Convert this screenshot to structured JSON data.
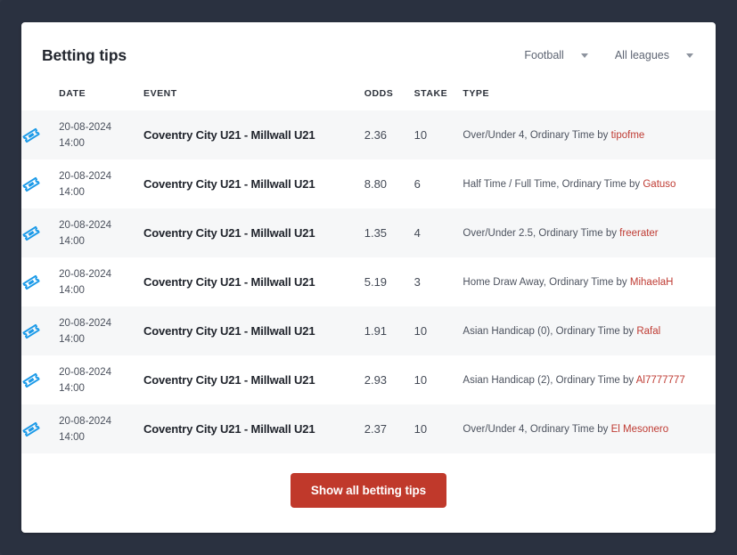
{
  "page": {
    "background_color": "#2a3140"
  },
  "card": {
    "title": "Betting tips",
    "filters": [
      {
        "name": "sport",
        "label": "Football",
        "icon": "chevron-down-icon"
      },
      {
        "name": "league",
        "label": "All leagues",
        "icon": "chevron-down-icon"
      }
    ],
    "table": {
      "columns": [
        "DATE",
        "EVENT",
        "ODDS",
        "STAKE",
        "TYPE"
      ],
      "rows": [
        {
          "icon": "ticket-icon",
          "date": "20-08-2024",
          "time": "14:00",
          "event": "Coventry City U21 - Millwall U21",
          "odds": "2.36",
          "stake": "10",
          "type": "Over/Under 4, Ordinary Time by",
          "tipster": "tipofme"
        },
        {
          "icon": "ticket-icon",
          "date": "20-08-2024",
          "time": "14:00",
          "event": "Coventry City U21 - Millwall U21",
          "odds": "8.80",
          "stake": "6",
          "type": "Half Time / Full Time, Ordinary Time by",
          "tipster": "Gatuso"
        },
        {
          "icon": "ticket-icon",
          "date": "20-08-2024",
          "time": "14:00",
          "event": "Coventry City U21 - Millwall U21",
          "odds": "1.35",
          "stake": "4",
          "type": "Over/Under 2.5, Ordinary Time by",
          "tipster": "freerater"
        },
        {
          "icon": "ticket-icon",
          "date": "20-08-2024",
          "time": "14:00",
          "event": "Coventry City U21 - Millwall U21",
          "odds": "5.19",
          "stake": "3",
          "type": "Home Draw Away, Ordinary Time by",
          "tipster": "MihaelaH"
        },
        {
          "icon": "ticket-icon",
          "date": "20-08-2024",
          "time": "14:00",
          "event": "Coventry City U21 - Millwall U21",
          "odds": "1.91",
          "stake": "10",
          "type": "Asian Handicap (0), Ordinary Time by",
          "tipster": "Rafal"
        },
        {
          "icon": "ticket-icon",
          "date": "20-08-2024",
          "time": "14:00",
          "event": "Coventry City U21 - Millwall U21",
          "odds": "2.93",
          "stake": "10",
          "type": "Asian Handicap (2), Ordinary Time by",
          "tipster": "Al7777777"
        },
        {
          "icon": "ticket-icon",
          "date": "20-08-2024",
          "time": "14:00",
          "event": "Coventry City U21 - Millwall U21",
          "odds": "2.37",
          "stake": "10",
          "type": "Over/Under 4, Ordinary Time by",
          "tipster": "El Mesonero"
        }
      ]
    },
    "footer": {
      "show_all_label": "Show all betting tips",
      "button_color": "#c0392b"
    }
  },
  "colors": {
    "tipster_link": "#bf3b33",
    "ticket_icon": "#1b9ae8",
    "row_stripe": "#f6f7f8"
  }
}
